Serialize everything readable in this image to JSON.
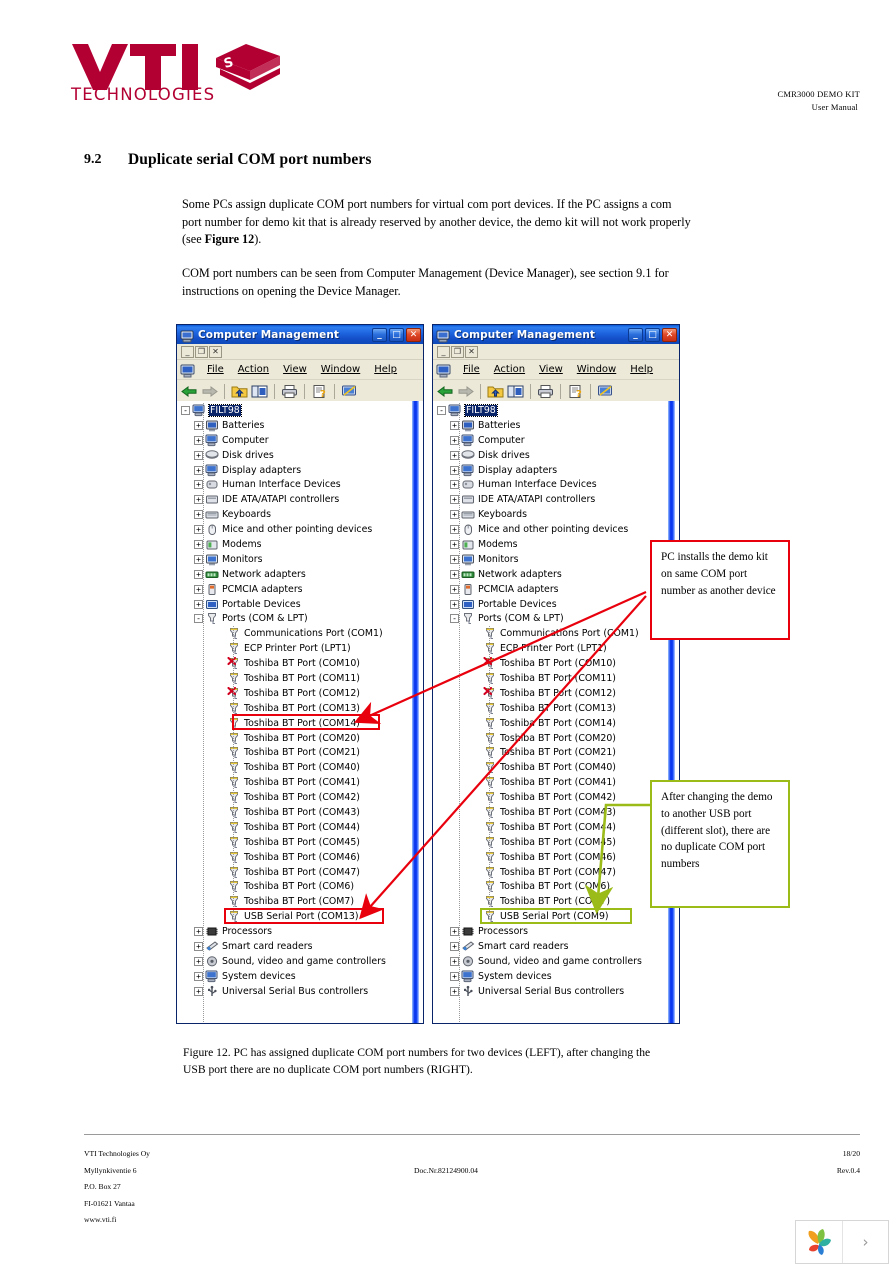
{
  "header": {
    "logo_text": "VTI",
    "logo_sub": "TECHNOLOGIES",
    "doc_title": "CMR3000 DEMO KIT",
    "doc_subtitle": "User Manual",
    "brand_color": "#b30033"
  },
  "section": {
    "number": "9.2",
    "title": "Duplicate serial COM port numbers",
    "paragraph1_a": "Some PCs assign duplicate COM port numbers for virtual com port devices. If the PC assigns a com port number for demo kit that is already reserved by another device, the demo kit will not work properly (see ",
    "paragraph1_b": "Figure 12",
    "paragraph1_c": ").",
    "paragraph2": "COM port numbers can be seen from Computer Management (Device Manager), see section 9.1 for instructions on opening the Device Manager."
  },
  "window": {
    "title": "Computer Management",
    "minimize_label": "_",
    "maximize_label": "□",
    "close_label": "✕",
    "mdi_min": "_",
    "mdi_restore": "❐",
    "mdi_close": "✕",
    "menu": [
      {
        "label": "File"
      },
      {
        "label": "Action"
      },
      {
        "label": "View"
      },
      {
        "label": "Window"
      },
      {
        "label": "Help"
      }
    ],
    "toolbar_icons": [
      "back-arrow-icon",
      "forward-arrow-icon",
      "up-folder-icon",
      "show-console-tree-icon",
      "print-icon",
      "help-icon",
      "scan-hardware-icon"
    ],
    "root_node": "FILT98"
  },
  "tree_categories": [
    "Batteries",
    "Computer",
    "Disk drives",
    "Display adapters",
    "Human Interface Devices",
    "IDE ATA/ATAPI controllers",
    "Keyboards",
    "Mice and other pointing devices",
    "Modems",
    "Monitors",
    "Network adapters",
    "PCMCIA adapters",
    "Portable Devices"
  ],
  "ports_node": "Ports (COM & LPT)",
  "tree_trailing": [
    "Processors",
    "Smart card readers",
    "Sound, video and game controllers",
    "System devices",
    "Universal Serial Bus controllers"
  ],
  "left_window": {
    "ports": [
      {
        "label": "Communications Port (COM1)",
        "disabled": false,
        "highlight": "none"
      },
      {
        "label": "ECP Printer Port (LPT1)",
        "disabled": false,
        "highlight": "none"
      },
      {
        "label": "Toshiba BT Port (COM10)",
        "disabled": true,
        "highlight": "none"
      },
      {
        "label": "Toshiba BT Port (COM11)",
        "disabled": false,
        "highlight": "none"
      },
      {
        "label": "Toshiba BT Port (COM12)",
        "disabled": true,
        "highlight": "none"
      },
      {
        "label": "Toshiba BT Port (COM13)",
        "disabled": false,
        "highlight": "red"
      },
      {
        "label": "Toshiba BT Port (COM14)",
        "disabled": false,
        "highlight": "none"
      },
      {
        "label": "Toshiba BT Port (COM20)",
        "disabled": false,
        "highlight": "none"
      },
      {
        "label": "Toshiba BT Port (COM21)",
        "disabled": false,
        "highlight": "none"
      },
      {
        "label": "Toshiba BT Port (COM40)",
        "disabled": false,
        "highlight": "none"
      },
      {
        "label": "Toshiba BT Port (COM41)",
        "disabled": false,
        "highlight": "none"
      },
      {
        "label": "Toshiba BT Port (COM42)",
        "disabled": false,
        "highlight": "none"
      },
      {
        "label": "Toshiba BT Port (COM43)",
        "disabled": false,
        "highlight": "none"
      },
      {
        "label": "Toshiba BT Port (COM44)",
        "disabled": false,
        "highlight": "none"
      },
      {
        "label": "Toshiba BT Port (COM45)",
        "disabled": false,
        "highlight": "none"
      },
      {
        "label": "Toshiba BT Port (COM46)",
        "disabled": false,
        "highlight": "none"
      },
      {
        "label": "Toshiba BT Port (COM47)",
        "disabled": false,
        "highlight": "none"
      },
      {
        "label": "Toshiba BT Port (COM6)",
        "disabled": false,
        "highlight": "none"
      },
      {
        "label": "Toshiba BT Port (COM7)",
        "disabled": false,
        "highlight": "none"
      },
      {
        "label": "USB Serial Port (COM13)",
        "disabled": false,
        "highlight": "red"
      }
    ]
  },
  "right_window": {
    "ports": [
      {
        "label": "Communications Port (COM1)",
        "disabled": false,
        "highlight": "none"
      },
      {
        "label": "ECP Printer Port (LPT1)",
        "disabled": false,
        "highlight": "none"
      },
      {
        "label": "Toshiba BT Port (COM10)",
        "disabled": true,
        "highlight": "none"
      },
      {
        "label": "Toshiba BT Port (COM11)",
        "disabled": false,
        "highlight": "none"
      },
      {
        "label": "Toshiba BT Port (COM12)",
        "disabled": true,
        "highlight": "none"
      },
      {
        "label": "Toshiba BT Port (COM13)",
        "disabled": false,
        "highlight": "none"
      },
      {
        "label": "Toshiba BT Port (COM14)",
        "disabled": false,
        "highlight": "none"
      },
      {
        "label": "Toshiba BT Port (COM20)",
        "disabled": false,
        "highlight": "none"
      },
      {
        "label": "Toshiba BT Port (COM21)",
        "disabled": false,
        "highlight": "none"
      },
      {
        "label": "Toshiba BT Port (COM40)",
        "disabled": false,
        "highlight": "none"
      },
      {
        "label": "Toshiba BT Port (COM41)",
        "disabled": false,
        "highlight": "none"
      },
      {
        "label": "Toshiba BT Port (COM42)",
        "disabled": false,
        "highlight": "none"
      },
      {
        "label": "Toshiba BT Port (COM43)",
        "disabled": false,
        "highlight": "none"
      },
      {
        "label": "Toshiba BT Port (COM44)",
        "disabled": false,
        "highlight": "none"
      },
      {
        "label": "Toshiba BT Port (COM45)",
        "disabled": false,
        "highlight": "none"
      },
      {
        "label": "Toshiba BT Port (COM46)",
        "disabled": false,
        "highlight": "none"
      },
      {
        "label": "Toshiba BT Port (COM47)",
        "disabled": false,
        "highlight": "none"
      },
      {
        "label": "Toshiba BT Port (COM6)",
        "disabled": false,
        "highlight": "none"
      },
      {
        "label": "Toshiba BT Port (COM7)",
        "disabled": false,
        "highlight": "none"
      },
      {
        "label": "USB Serial Port (COM9)",
        "disabled": false,
        "highlight": "green"
      }
    ]
  },
  "annotations": {
    "callout_red": "PC installs the demo kit on same COM port number as another device",
    "callout_green": "After changing the demo to another USB port (different slot), there are no duplicate COM port numbers",
    "red_color": "#e8000d",
    "green_color": "#9bbb18"
  },
  "caption": "Figure 12. PC has assigned duplicate COM port numbers for two devices (LEFT), after changing the USB port there are no duplicate COM port numbers (RIGHT).",
  "footer": {
    "company": "VTI Technologies Oy",
    "street": "Myllynkiventie 6",
    "pobox": "P.O. Box 27",
    "city": "FI-01621 Vantaa",
    "web": "www.vti.fi",
    "doc_nr": "Doc.Nr.82124900.04",
    "page": "18/20",
    "rev": "Rev.0.4"
  },
  "viewer_widget": {
    "next_label": "›"
  }
}
